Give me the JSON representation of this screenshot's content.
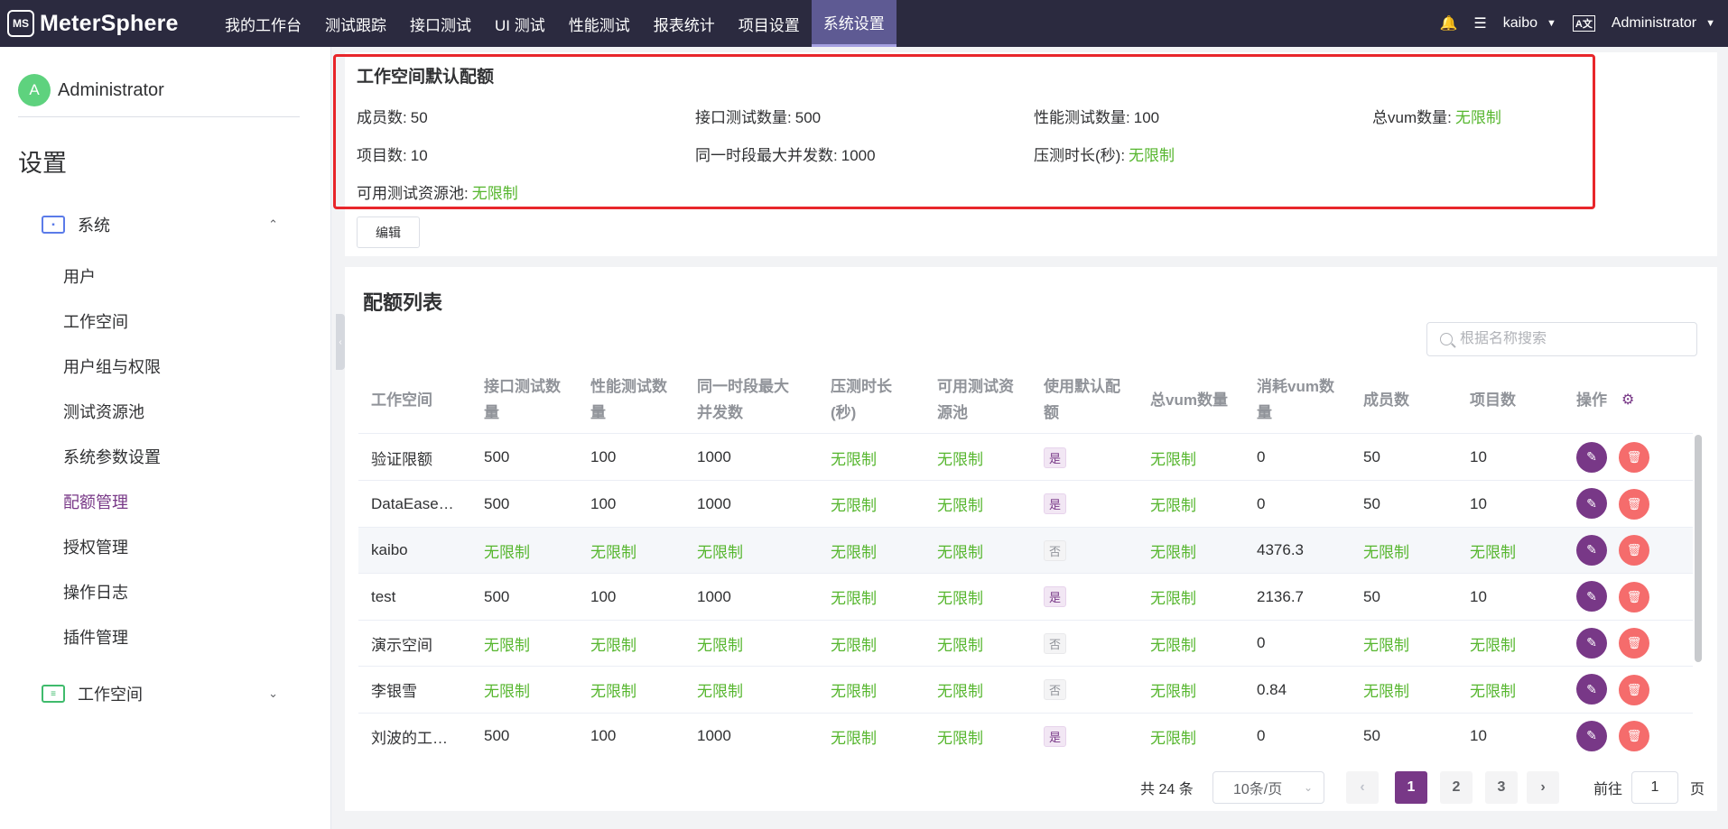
{
  "app": {
    "brand": "MeterSphere",
    "logo_text": "MS"
  },
  "nav": {
    "items": [
      "我的工作台",
      "测试跟踪",
      "接口测试",
      "UI 测试",
      "性能测试",
      "报表统计",
      "项目设置",
      "系统设置"
    ],
    "active_index": 7
  },
  "header_right": {
    "bell": "bell-icon",
    "tasks": "task-list-icon",
    "workspace": "kaibo",
    "lang": "A文",
    "role": "Administrator"
  },
  "sidebar": {
    "user": {
      "avatar": "A",
      "name": "Administrator"
    },
    "title": "设置",
    "system_group": "系统",
    "items": [
      "用户",
      "工作空间",
      "用户组与权限",
      "测试资源池",
      "系统参数设置",
      "配额管理",
      "授权管理",
      "操作日志",
      "插件管理"
    ],
    "active_index": 5,
    "workspace_group": "工作空间"
  },
  "quota": {
    "title": "工作空间默认配额",
    "fields": [
      {
        "label": "成员数:",
        "value": "50",
        "unlimited": false
      },
      {
        "label": "接口测试数量:",
        "value": "500",
        "unlimited": false
      },
      {
        "label": "性能测试数量:",
        "value": "100",
        "unlimited": false
      },
      {
        "label": "总vum数量:",
        "value": "无限制",
        "unlimited": true
      },
      {
        "label": "项目数:",
        "value": "10",
        "unlimited": false
      },
      {
        "label": "同一时段最大并发数:",
        "value": "1000",
        "unlimited": false
      },
      {
        "label": "压测时长(秒):",
        "value": "无限制",
        "unlimited": true
      },
      {
        "label": "可用测试资源池:",
        "value": "无限制",
        "unlimited": true
      }
    ],
    "edit_label": "编辑"
  },
  "list": {
    "title": "配额列表",
    "search_placeholder": "根据名称搜索",
    "columns": [
      [
        "工作空间"
      ],
      [
        "接口测试数",
        "量"
      ],
      [
        "性能测试数",
        "量"
      ],
      [
        "同一时段最大",
        "并发数"
      ],
      [
        "压测时长",
        "(秒)"
      ],
      [
        "可用测试资",
        "源池"
      ],
      [
        "使用默认配",
        "额"
      ],
      [
        "总vum数量"
      ],
      [
        "消耗vum数",
        "量"
      ],
      [
        "成员数"
      ],
      [
        "项目数"
      ],
      [
        "操作"
      ]
    ],
    "rows": [
      [
        "验证限额",
        "500",
        "100",
        "1000",
        "无限制",
        "无限制",
        "是",
        "无限制",
        "0",
        "50",
        "10"
      ],
      [
        "DataEase…",
        "500",
        "100",
        "1000",
        "无限制",
        "无限制",
        "是",
        "无限制",
        "0",
        "50",
        "10"
      ],
      [
        "kaibo",
        "无限制",
        "无限制",
        "无限制",
        "无限制",
        "无限制",
        "否",
        "无限制",
        "4376.3",
        "无限制",
        "无限制"
      ],
      [
        "test",
        "500",
        "100",
        "1000",
        "无限制",
        "无限制",
        "是",
        "无限制",
        "2136.7",
        "50",
        "10"
      ],
      [
        "演示空间",
        "无限制",
        "无限制",
        "无限制",
        "无限制",
        "无限制",
        "否",
        "无限制",
        "0",
        "无限制",
        "无限制"
      ],
      [
        "李银雪",
        "无限制",
        "无限制",
        "无限制",
        "无限制",
        "无限制",
        "否",
        "无限制",
        "0.84",
        "无限制",
        "无限制"
      ],
      [
        "刘波的工…",
        "500",
        "100",
        "1000",
        "无限制",
        "无限制",
        "是",
        "无限制",
        "0",
        "50",
        "10"
      ]
    ],
    "hover_row": 2
  },
  "pagination": {
    "total": "共 24 条",
    "page_size": "10条/页",
    "pages": [
      "1",
      "2",
      "3"
    ],
    "current": "1",
    "goto_prefix": "前往",
    "goto_value": "1",
    "goto_suffix": "页"
  },
  "colors": {
    "brand": "#783887",
    "unlimited": "#56b62e",
    "danger": "#f56c6c",
    "nav_bg": "#2b2a3f",
    "highlight": "#e8262b"
  }
}
